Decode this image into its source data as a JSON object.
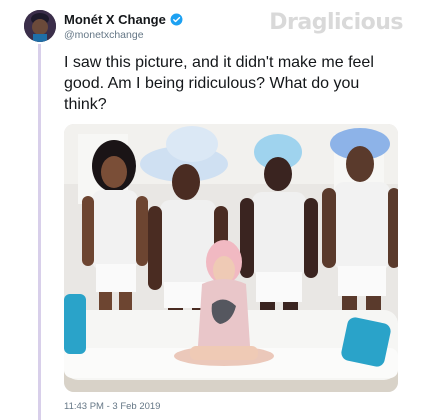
{
  "tweet": {
    "author_name": "Monét X Change",
    "handle": "@monetxchange",
    "verified": true,
    "text": "I saw this picture, and it didn't make me feel good. Am I being ridiculous? What do you think?",
    "timestamp": "11:43 PM - 3 Feb 2019"
  },
  "watermark": "Draglicious",
  "icons": {
    "verified": "verified-badge-icon"
  },
  "colors": {
    "thread_line": "#d8cfea",
    "verified_blue": "#1da1f2",
    "sofa_teal": "#2aa3c9"
  }
}
